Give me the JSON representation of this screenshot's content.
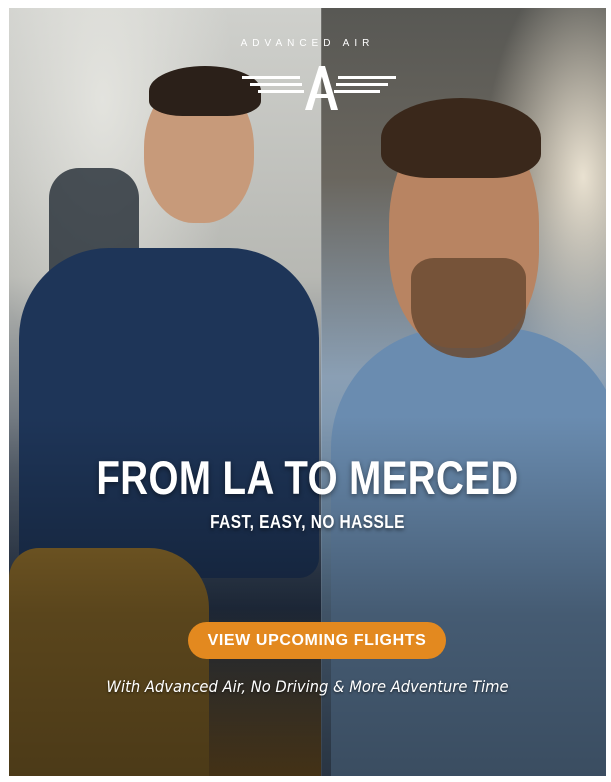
{
  "brand": {
    "name": "ADVANCED AIR",
    "logo_icon": "winged-a-logo-icon"
  },
  "hero": {
    "headline": "FROM LA TO MERCED",
    "subheadline": "FAST, EASY, NO HASSLE",
    "cta_label": "VIEW UPCOMING FLIGHTS",
    "tagline": "With Advanced Air, No Driving & More Adventure Time"
  },
  "colors": {
    "cta_background": "#e3891f",
    "text": "#ffffff"
  }
}
